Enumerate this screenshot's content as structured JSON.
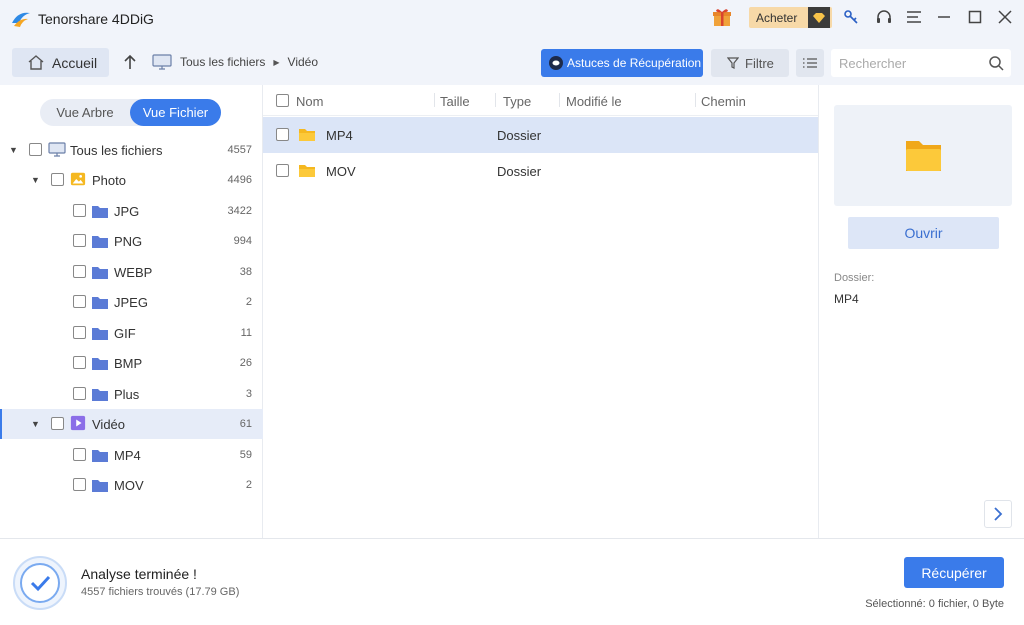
{
  "app": {
    "title": "Tenorshare 4DDiG",
    "buy_label": "Acheter"
  },
  "toolbar": {
    "home_label": "Accueil",
    "breadcrumb": [
      "Tous les fichiers",
      "Vidéo"
    ],
    "tips_label": "Astuces de Récupération",
    "filter_label": "Filtre",
    "search_placeholder": "Rechercher"
  },
  "sidebar": {
    "view_tree": "Vue Arbre",
    "view_file": "Vue Fichier",
    "items": [
      {
        "label": "Tous les fichiers",
        "count": "4557"
      },
      {
        "label": "Photo",
        "count": "4496"
      },
      {
        "label": "JPG",
        "count": "3422"
      },
      {
        "label": "PNG",
        "count": "994"
      },
      {
        "label": "WEBP",
        "count": "38"
      },
      {
        "label": "JPEG",
        "count": "2"
      },
      {
        "label": "GIF",
        "count": "11"
      },
      {
        "label": "BMP",
        "count": "26"
      },
      {
        "label": "Plus",
        "count": "3"
      },
      {
        "label": "Vidéo",
        "count": "61"
      },
      {
        "label": "MP4",
        "count": "59"
      },
      {
        "label": "MOV",
        "count": "2"
      }
    ]
  },
  "table": {
    "columns": [
      "Nom",
      "Taille",
      "Type",
      "Modifié le",
      "Chemin"
    ],
    "rows": [
      {
        "name": "MP4",
        "type": "Dossier"
      },
      {
        "name": "MOV",
        "type": "Dossier"
      }
    ]
  },
  "preview": {
    "open_label": "Ouvrir",
    "meta_label": "Dossier:",
    "meta_value": "MP4"
  },
  "footer": {
    "status_title": "Analyse terminée !",
    "status_sub": "4557 fichiers trouvés (17.79 GB)",
    "recover_label": "Récupérer",
    "selected_info": "Sélectionné: 0 fichier, 0 Byte"
  },
  "colors": {
    "accent": "#3a7bea",
    "folder": "#f5b820",
    "folder_blue": "#5b7bd6",
    "buy": "#f7d9a8"
  }
}
